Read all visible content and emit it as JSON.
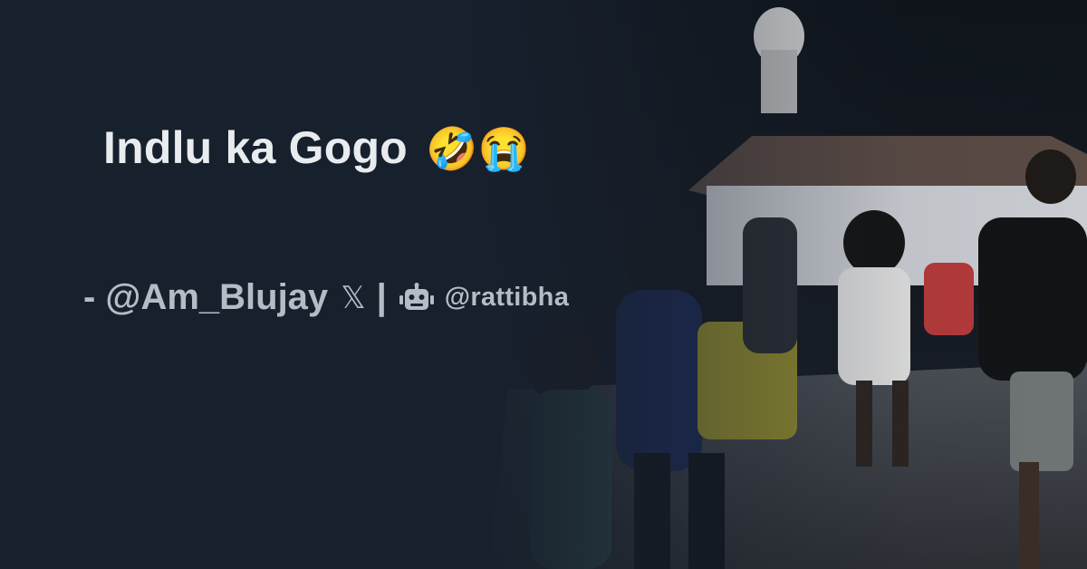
{
  "post": {
    "title": "Indlu ka Gogo",
    "emoji": "🤣😭",
    "author": "- @Am_Blujay",
    "platform_mark": "𝕏",
    "separator": "|",
    "site": "@rattibha"
  },
  "icons": {
    "platform": "x-logo-icon",
    "bot": "robot-icon"
  },
  "colors": {
    "background": "#17202d",
    "title": "#e8ecef",
    "byline": "#b4bcc6"
  }
}
